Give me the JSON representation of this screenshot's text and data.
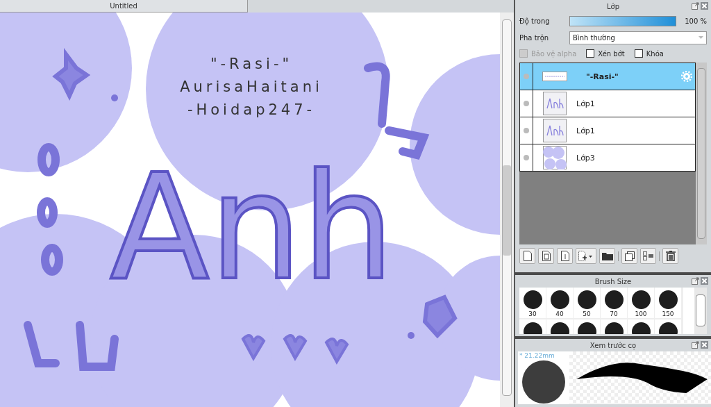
{
  "document_tab": {
    "title": "Untitled"
  },
  "canvas": {
    "lines": [
      "\"-Rasi-\"",
      "AurisaHaitani",
      "-Hoidap247-"
    ],
    "lettering": "Anh"
  },
  "layer_panel": {
    "title": "Lớp",
    "opacity": {
      "label": "Độ trong",
      "level": 1,
      "reading": "100 %"
    },
    "blend": {
      "label": "Pha trộn",
      "value": "Bình thường"
    },
    "options": [
      {
        "label": "Bảo vệ alpha",
        "checked": false,
        "disabled": true
      },
      {
        "label": "Xén bớt",
        "checked": false,
        "disabled": false
      },
      {
        "label": "Khóa",
        "checked": false,
        "disabled": false
      }
    ],
    "layers": [
      {
        "name": "\"-Rasi-\"",
        "selected": true,
        "kind": "text"
      },
      {
        "name": "Lớp1",
        "selected": false,
        "kind": "sketch"
      },
      {
        "name": "Lớp1",
        "selected": false,
        "kind": "sketch"
      },
      {
        "name": "Lớp3",
        "selected": false,
        "kind": "circles"
      }
    ]
  },
  "brush_size_panel": {
    "title": "Brush Size",
    "sizes": [
      "30",
      "40",
      "50",
      "70",
      "100",
      "150"
    ]
  },
  "brush_preview_panel": {
    "title": "Xem trước cọ",
    "size": "* 21.22mm"
  }
}
